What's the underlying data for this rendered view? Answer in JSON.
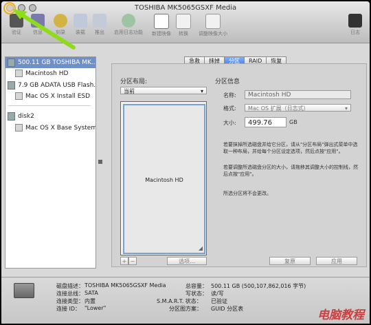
{
  "window": {
    "title": "TOSHIBA MK5065GSXF Media"
  },
  "toolbar": {
    "buttons": [
      {
        "label": "验证",
        "name": "verify"
      },
      {
        "label": "信息",
        "name": "info"
      },
      {
        "label": "刻录",
        "name": "burn"
      },
      {
        "label": "装载",
        "name": "mount"
      },
      {
        "label": "推出",
        "name": "eject"
      },
      {
        "label": "启用日志功能",
        "name": "enable-journaling"
      },
      {
        "label": "新建映像",
        "name": "new-image"
      },
      {
        "label": "转换",
        "name": "convert"
      },
      {
        "label": "调整映像大小",
        "name": "resize-image"
      }
    ],
    "log_label": "日志"
  },
  "sidebar": {
    "items": [
      {
        "label": "500.11 GB TOSHIBA MK...",
        "type": "disk",
        "selected": true
      },
      {
        "label": "Macintosh HD",
        "type": "volume"
      },
      {
        "label": "7.9 GB ADATA USB Flash...",
        "type": "disk"
      },
      {
        "label": "Mac OS X Install ESD",
        "type": "volume"
      },
      {
        "label": "disk2",
        "type": "disk"
      },
      {
        "label": "Mac OS X Base System",
        "type": "volume"
      }
    ]
  },
  "tabs": [
    {
      "label": "急救",
      "active": false
    },
    {
      "label": "抹掉",
      "active": false
    },
    {
      "label": "分区",
      "active": true
    },
    {
      "label": "RAID",
      "active": false
    },
    {
      "label": "恢复",
      "active": false
    }
  ],
  "partition": {
    "layout_title": "分区布局:",
    "layout_value": "当前",
    "info_title": "分区信息",
    "name_label": "名称:",
    "name_value": "Macintosh HD",
    "format_label": "格式:",
    "format_value": "Mac OS 扩展（日志式）",
    "size_label": "大小:",
    "size_value": "499.76",
    "size_unit": "GB",
    "map_label": "Macintosh HD",
    "desc1": "若要抹掉所选磁盘并给它分区，请从\"分区布局\"弹出式菜单中选取一种布局，并给每个分区设定选项，然后点按\"应用\"。",
    "desc2": "若要调整所选磁盘分区的大小，请拖移其调整大小的控制线，然后点按\"应用\"。",
    "desc3": "所选分区将不会更改。",
    "plus": "+",
    "minus": "−",
    "options": "选项...",
    "revert": "复原",
    "apply": "应用"
  },
  "details": {
    "desc_label": "磁盘描述：",
    "desc_value": "TOSHIBA MK5065GSXF Media",
    "bus_label": "连接总线：",
    "bus_value": "SATA",
    "type_label": "连接类型：",
    "type_value": "内置",
    "id_label": "连接 ID：",
    "id_value": "\"Lower\"",
    "capacity_label": "总容量：",
    "capacity_value": "500.11 GB (500,107,862,016 字节)",
    "write_label": "写状态：",
    "write_value": "读/写",
    "smart_label": "S.M.A.R.T. 状态：",
    "smart_value": "已验证",
    "scheme_label": "分区图方案：",
    "scheme_value": "GUID 分区表"
  },
  "watermark": "电脑教程",
  "colors": {
    "arrow": "#8fdd1a",
    "highlight": "#e8ac22",
    "selected": "#3875d7"
  }
}
